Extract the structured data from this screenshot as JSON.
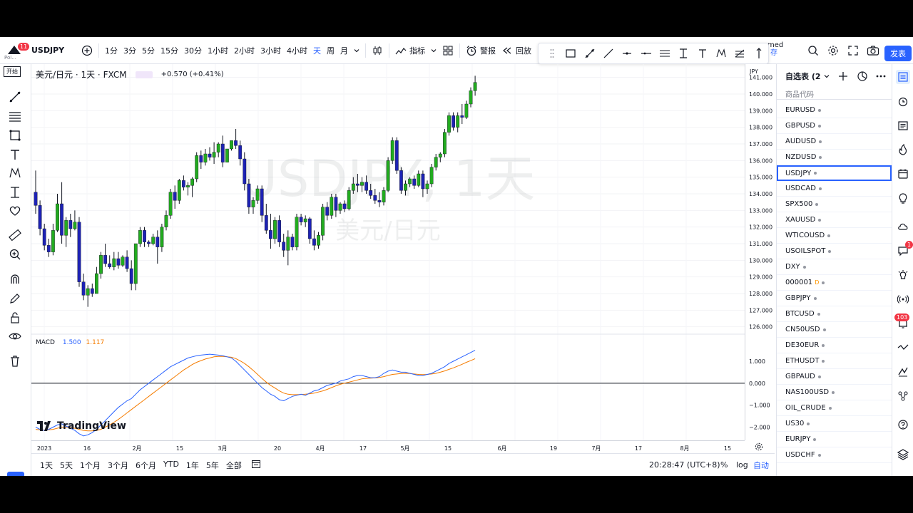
{
  "toolbar": {
    "symbol": "USDJPY",
    "avatar_badge": "11",
    "avatar_label": "Poi...",
    "start_tip": "开始",
    "intervals": [
      "1分",
      "3分",
      "5分",
      "15分",
      "30分",
      "1小时",
      "2小时",
      "3小时",
      "4小时",
      "天",
      "周",
      "月"
    ],
    "selected_interval": "天",
    "indicators_label": "指标",
    "alert_label": "警报",
    "replay_label": "回放",
    "layout_name": "med",
    "layout_sub": "存",
    "publish_label": "发表"
  },
  "legend": {
    "title": "美元/日元 · 1天 · FXCM",
    "change": "+0.570 (+0.41%)"
  },
  "watermark": {
    "symbol": "USDJPY, 1天",
    "desc": "美元/日元"
  },
  "macd": {
    "label": "MACD",
    "macd_value": "1.500",
    "signal_value": "1.117"
  },
  "brand": "TradingView",
  "price_scale": {
    "currency": "JPY",
    "main_ticks": [
      "141.000",
      "140.000",
      "139.000",
      "138.000",
      "137.000",
      "136.000",
      "135.000",
      "134.000",
      "133.000",
      "132.000",
      "131.000",
      "130.000",
      "129.000",
      "128.000",
      "127.000",
      "126.000"
    ],
    "macd_ticks": [
      "1.000",
      "0.000",
      "−1.000",
      "−2.000"
    ]
  },
  "time_axis": [
    "2023",
    "16",
    "2月",
    "15",
    "3月",
    "20",
    "4月",
    "17",
    "5月",
    "15",
    "6月",
    "19",
    "7月",
    "17",
    "8月",
    "15"
  ],
  "bottom": {
    "ranges": [
      "1天",
      "5天",
      "1个月",
      "3个月",
      "6个月",
      "YTD",
      "1年",
      "5年",
      "全部"
    ],
    "clock": "20:28:47 (UTC+8)",
    "pct": "%",
    "log": "log",
    "auto": "自动"
  },
  "watchlist": {
    "title": "自选表 (2",
    "column": "商品代码",
    "items": [
      "EURUSD",
      "GBPUSD",
      "AUDUSD",
      "NZDUSD",
      "USDJPY",
      "USDCAD",
      "SPX500",
      "XAUUSD",
      "WTICOUSD",
      "USOILSPOT",
      "DXY",
      "000001",
      "GBPJPY",
      "BTCUSD",
      "CN50USD",
      "DE30EUR",
      "ETHUSDT",
      "GBPAUD",
      "NAS100USD",
      "OIL_CRUDE",
      "US30",
      "EURJPY",
      "USDCHF"
    ],
    "active": "USDJPY",
    "flag_item": "000001",
    "flag_letter": "D"
  },
  "right_badges": {
    "chat": "1",
    "notifications": "103"
  },
  "colors": {
    "up": "#22ab1f",
    "down": "#1d22b4",
    "macd": "#2962ff",
    "signal": "#f57c00",
    "accent": "#2962ff"
  },
  "chart_data": {
    "type": "candlestick",
    "y_range": [
      125.6,
      141.8
    ],
    "ohlc": [
      [
        134.1,
        135.4,
        132.8,
        133.3
      ],
      [
        133.3,
        133.6,
        131.5,
        131.9
      ],
      [
        131.9,
        132.2,
        130.6,
        130.9
      ],
      [
        130.9,
        131.3,
        130.2,
        130.5
      ],
      [
        130.5,
        132.2,
        130.3,
        131.8
      ],
      [
        131.8,
        134.0,
        131.7,
        133.4
      ],
      [
        133.4,
        134.7,
        131.0,
        131.5
      ],
      [
        131.5,
        132.6,
        130.8,
        132.4
      ],
      [
        132.4,
        132.8,
        131.4,
        131.9
      ],
      [
        131.9,
        133.0,
        131.8,
        132.3
      ],
      [
        132.3,
        132.6,
        128.4,
        128.7
      ],
      [
        128.7,
        129.2,
        127.6,
        127.9
      ],
      [
        127.9,
        128.5,
        127.2,
        128.3
      ],
      [
        128.3,
        128.6,
        127.8,
        128.0
      ],
      [
        128.0,
        129.6,
        128.0,
        129.2
      ],
      [
        129.2,
        130.5,
        128.9,
        130.3
      ],
      [
        130.3,
        131.0,
        129.6,
        129.8
      ],
      [
        129.8,
        130.3,
        129.5,
        129.6
      ],
      [
        129.6,
        130.5,
        129.4,
        130.1
      ],
      [
        130.1,
        130.5,
        129.5,
        129.7
      ],
      [
        129.7,
        130.3,
        129.6,
        130.2
      ],
      [
        130.2,
        130.6,
        129.3,
        129.5
      ],
      [
        129.5,
        130.0,
        128.2,
        128.6
      ],
      [
        128.6,
        130.0,
        128.2,
        131.0
      ],
      [
        131.0,
        132.0,
        130.8,
        131.8
      ],
      [
        131.8,
        132.0,
        130.8,
        131.1
      ],
      [
        131.1,
        131.2,
        130.8,
        131.0
      ],
      [
        131.0,
        131.6,
        130.9,
        131.4
      ],
      [
        131.4,
        131.8,
        129.8,
        130.8
      ],
      [
        130.8,
        132.2,
        130.5,
        132.0
      ],
      [
        132.0,
        133.0,
        131.8,
        132.7
      ],
      [
        132.7,
        134.3,
        132.5,
        134.1
      ],
      [
        134.1,
        134.5,
        133.1,
        133.6
      ],
      [
        133.6,
        134.9,
        133.4,
        134.8
      ],
      [
        134.8,
        135.1,
        134.2,
        134.4
      ],
      [
        134.4,
        134.7,
        133.9,
        134.5
      ],
      [
        134.5,
        135.0,
        133.8,
        134.9
      ],
      [
        134.9,
        136.5,
        134.7,
        136.3
      ],
      [
        136.3,
        136.6,
        135.5,
        135.9
      ],
      [
        135.9,
        136.7,
        135.7,
        136.4
      ],
      [
        136.4,
        136.8,
        136.0,
        136.2
      ],
      [
        136.2,
        137.1,
        135.8,
        136.5
      ],
      [
        136.5,
        137.1,
        136.2,
        137.0
      ],
      [
        137.0,
        137.5,
        135.6,
        135.9
      ],
      [
        135.9,
        136.7,
        135.9,
        136.7
      ],
      [
        136.7,
        137.2,
        136.6,
        137.2
      ],
      [
        137.2,
        137.9,
        136.7,
        136.9
      ],
      [
        136.9,
        137.2,
        135.7,
        136.1
      ],
      [
        136.1,
        136.5,
        134.2,
        134.6
      ],
      [
        134.6,
        134.9,
        132.8,
        133.2
      ],
      [
        133.2,
        133.8,
        132.8,
        133.6
      ],
      [
        133.6,
        134.5,
        133.4,
        134.3
      ],
      [
        134.3,
        134.5,
        132.3,
        132.7
      ],
      [
        132.7,
        133.4,
        131.6,
        131.8
      ],
      [
        131.8,
        132.8,
        130.7,
        131.3
      ],
      [
        131.3,
        132.6,
        131.0,
        132.4
      ],
      [
        132.4,
        132.7,
        130.8,
        131.1
      ],
      [
        131.1,
        131.6,
        130.2,
        130.6
      ],
      [
        130.6,
        131.8,
        129.7,
        131.4
      ],
      [
        131.4,
        131.6,
        130.6,
        130.8
      ],
      [
        130.8,
        132.8,
        130.6,
        132.6
      ],
      [
        132.6,
        132.8,
        132.1,
        132.3
      ],
      [
        132.3,
        132.7,
        132.0,
        132.5
      ],
      [
        132.5,
        132.6,
        131.0,
        131.3
      ],
      [
        131.3,
        131.8,
        130.6,
        130.9
      ],
      [
        130.9,
        131.7,
        130.7,
        131.5
      ],
      [
        131.5,
        133.4,
        131.2,
        133.2
      ],
      [
        133.2,
        133.5,
        132.4,
        132.7
      ],
      [
        132.7,
        134.0,
        132.5,
        133.8
      ],
      [
        133.8,
        134.0,
        132.6,
        133.0
      ],
      [
        133.0,
        133.5,
        132.8,
        133.4
      ],
      [
        133.4,
        133.6,
        132.9,
        133.1
      ],
      [
        133.1,
        134.4,
        133.0,
        134.2
      ],
      [
        134.2,
        135.0,
        134.0,
        134.6
      ],
      [
        134.6,
        135.2,
        134.1,
        134.5
      ],
      [
        134.5,
        135.0,
        134.1,
        134.7
      ],
      [
        134.7,
        135.1,
        134.0,
        134.2
      ],
      [
        134.2,
        134.6,
        133.7,
        133.9
      ],
      [
        133.9,
        134.3,
        133.4,
        133.6
      ],
      [
        133.6,
        134.1,
        133.2,
        133.5
      ],
      [
        133.5,
        134.4,
        133.3,
        134.2
      ],
      [
        134.2,
        136.2,
        134.1,
        136.0
      ],
      [
        136.0,
        137.4,
        135.8,
        137.2
      ],
      [
        137.2,
        137.4,
        135.2,
        135.4
      ],
      [
        135.4,
        135.6,
        134.0,
        134.2
      ],
      [
        134.2,
        134.8,
        133.9,
        134.6
      ],
      [
        134.6,
        135.0,
        134.4,
        134.9
      ],
      [
        134.9,
        135.1,
        134.3,
        134.5
      ],
      [
        134.5,
        135.4,
        134.4,
        135.2
      ],
      [
        135.2,
        135.4,
        133.8,
        134.3
      ],
      [
        134.3,
        134.8,
        134.0,
        134.6
      ],
      [
        134.6,
        135.8,
        134.4,
        135.6
      ],
      [
        135.6,
        136.4,
        135.4,
        136.2
      ],
      [
        136.2,
        136.5,
        135.9,
        136.4
      ],
      [
        136.4,
        137.9,
        136.2,
        137.7
      ],
      [
        137.7,
        138.9,
        137.5,
        138.7
      ],
      [
        138.7,
        138.9,
        137.8,
        138.0
      ],
      [
        138.0,
        138.9,
        137.7,
        138.7
      ],
      [
        138.7,
        139.4,
        138.2,
        138.6
      ],
      [
        138.6,
        139.6,
        138.5,
        139.4
      ],
      [
        139.4,
        140.4,
        139.2,
        140.2
      ],
      [
        140.2,
        141.1,
        139.9,
        140.7
      ]
    ],
    "macd": [
      -2.0,
      -2.1,
      -2.15,
      -2.1,
      -2.0,
      -1.9,
      -1.85,
      -1.95,
      -2.05,
      -2.15,
      -2.3,
      -2.4,
      -2.35,
      -2.25,
      -2.1,
      -1.9,
      -1.7,
      -1.5,
      -1.3,
      -1.1,
      -0.95,
      -0.8,
      -0.7,
      -0.5,
      -0.3,
      -0.15,
      0.0,
      0.15,
      0.3,
      0.45,
      0.6,
      0.75,
      0.85,
      0.95,
      1.05,
      1.15,
      1.2,
      1.25,
      1.28,
      1.3,
      1.32,
      1.3,
      1.28,
      1.25,
      1.2,
      1.15,
      1.0,
      0.8,
      0.6,
      0.4,
      0.2,
      0.0,
      -0.2,
      -0.35,
      -0.5,
      -0.6,
      -0.75,
      -0.8,
      -0.7,
      -0.6,
      -0.55,
      -0.5,
      -0.55,
      -0.45,
      -0.35,
      -0.3,
      -0.2,
      -0.1,
      -0.05,
      0.0,
      0.1,
      0.15,
      0.2,
      0.3,
      0.35,
      0.35,
      0.3,
      0.25,
      0.25,
      0.3,
      0.45,
      0.55,
      0.6,
      0.55,
      0.5,
      0.5,
      0.45,
      0.4,
      0.35,
      0.35,
      0.4,
      0.45,
      0.55,
      0.65,
      0.75,
      0.9,
      1.0,
      1.1,
      1.2,
      1.3,
      1.4,
      1.5
    ],
    "signal": [
      -2.1,
      -2.12,
      -2.13,
      -2.12,
      -2.1,
      -2.05,
      -2.0,
      -2.0,
      -2.02,
      -2.05,
      -2.1,
      -2.15,
      -2.17,
      -2.17,
      -2.15,
      -2.1,
      -2.0,
      -1.9,
      -1.78,
      -1.65,
      -1.5,
      -1.35,
      -1.2,
      -1.05,
      -0.9,
      -0.75,
      -0.6,
      -0.45,
      -0.3,
      -0.15,
      0.0,
      0.15,
      0.3,
      0.45,
      0.6,
      0.72,
      0.85,
      0.95,
      1.03,
      1.1,
      1.15,
      1.2,
      1.22,
      1.22,
      1.2,
      1.18,
      1.12,
      1.02,
      0.9,
      0.75,
      0.58,
      0.4,
      0.22,
      0.05,
      -0.1,
      -0.22,
      -0.35,
      -0.45,
      -0.5,
      -0.52,
      -0.52,
      -0.51,
      -0.5,
      -0.48,
      -0.45,
      -0.4,
      -0.35,
      -0.28,
      -0.2,
      -0.12,
      -0.05,
      0.0,
      0.05,
      0.1,
      0.15,
      0.2,
      0.22,
      0.23,
      0.24,
      0.26,
      0.3,
      0.35,
      0.4,
      0.42,
      0.44,
      0.45,
      0.44,
      0.42,
      0.4,
      0.39,
      0.4,
      0.42,
      0.45,
      0.5,
      0.56,
      0.63,
      0.7,
      0.78,
      0.86,
      0.95,
      1.03,
      1.117
    ],
    "macd_range": [
      -2.6,
      2.2
    ],
    "x_labels": [
      "2023",
      "16",
      "2月",
      "15",
      "3月",
      "20",
      "4月",
      "17",
      "5月",
      "15",
      "6月",
      "19",
      "7月",
      "17",
      "8月",
      "15"
    ]
  }
}
